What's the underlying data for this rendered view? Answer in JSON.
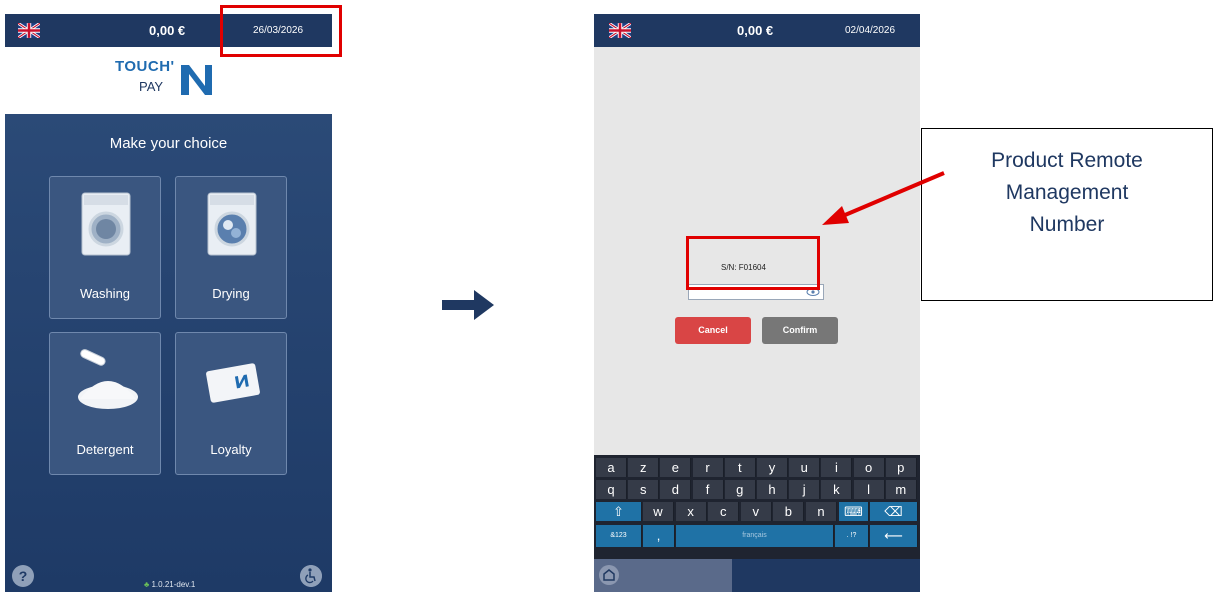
{
  "left_screen": {
    "header": {
      "amount": "0,00 €",
      "date": "26/03/2026"
    },
    "logo": {
      "line1": "TOUCH'",
      "line2": "PAY"
    },
    "title": "Make your choice",
    "cards": [
      {
        "label": "Washing"
      },
      {
        "label": "Drying"
      },
      {
        "label": "Detergent"
      },
      {
        "label": "Loyalty"
      }
    ],
    "help_label": "?",
    "version": "1.0.21-dev.1"
  },
  "right_screen": {
    "header": {
      "amount": "0,00 €",
      "date": "02/04/2026"
    },
    "serial": "S/N: F01604",
    "cancel_label": "Cancel",
    "confirm_label": "Confirm",
    "keyboard": {
      "row1": [
        "a",
        "z",
        "e",
        "r",
        "t",
        "y",
        "u",
        "i",
        "o",
        "p"
      ],
      "row2": [
        "q",
        "s",
        "d",
        "f",
        "g",
        "h",
        "j",
        "k",
        "l",
        "m"
      ],
      "row3": [
        "w",
        "x",
        "c",
        "v",
        "b",
        "n"
      ],
      "symbols_label": "&123",
      "comma_label": ",",
      "space_label": "français",
      "period_label": ". !?"
    }
  },
  "annotation": {
    "text": "Product Remote\nManagement\nNumber"
  },
  "colors": {
    "navy": "#1f3861",
    "highlight_red": "#e00000",
    "cancel_red": "#d94545",
    "confirm_gray": "#777777"
  }
}
